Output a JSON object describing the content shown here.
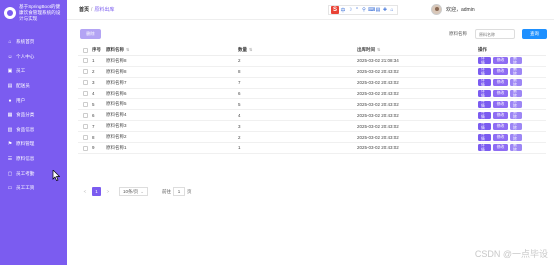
{
  "sidebar": {
    "title": "基于SpringBoot的健康饮食管理系统的设计与实现",
    "items": [
      {
        "label": "系统首页",
        "icon": "home-icon",
        "glyph": "⌂"
      },
      {
        "label": "个人中心",
        "icon": "user-icon",
        "glyph": "☺"
      },
      {
        "label": "员工",
        "icon": "id-card-icon",
        "glyph": "▣"
      },
      {
        "label": "配送员",
        "icon": "truck-icon",
        "glyph": "▤"
      },
      {
        "label": "用户",
        "icon": "users-icon",
        "glyph": "●"
      },
      {
        "label": "食品分类",
        "icon": "category-icon",
        "glyph": "▦"
      },
      {
        "label": "食品信息",
        "icon": "goods-icon",
        "glyph": "▥"
      },
      {
        "label": "原料管理",
        "icon": "flag-icon",
        "glyph": "⚑"
      },
      {
        "label": "原料信息",
        "icon": "list-icon",
        "glyph": "☰"
      },
      {
        "label": "员工考勤",
        "icon": "calendar-icon",
        "glyph": "▢"
      },
      {
        "label": "员工工资",
        "icon": "wallet-icon",
        "glyph": "▭"
      }
    ]
  },
  "header": {
    "crumb_home": "首页",
    "crumb_current": "原料出库",
    "greeting": "欢迎，admin",
    "toolbar_icons": [
      "S",
      "中",
      "☽",
      "°",
      "⚲",
      "⌨",
      "▤",
      "✚",
      "⌂"
    ]
  },
  "toolbar": {
    "delete_label": "删除",
    "search_label": "原料名称",
    "search_placeholder": "原料名称",
    "search_button": "查询"
  },
  "table": {
    "headers": {
      "index": "序号",
      "name": "原料名称",
      "qty": "数量",
      "time": "出库时间",
      "ops": "操作"
    },
    "op_labels": {
      "detail": "详情",
      "edit": "修改",
      "delete": "删除"
    },
    "rows": [
      {
        "index": "1",
        "name": "原料名称8",
        "qty": "2",
        "time": "2025-03-02 21:08:34"
      },
      {
        "index": "2",
        "name": "原料名称8",
        "qty": "8",
        "time": "2025-03-02 20:43:02"
      },
      {
        "index": "3",
        "name": "原料名称7",
        "qty": "7",
        "time": "2025-03-02 20:43:02"
      },
      {
        "index": "4",
        "name": "原料名称6",
        "qty": "6",
        "time": "2025-03-02 20:43:02"
      },
      {
        "index": "5",
        "name": "原料名称5",
        "qty": "5",
        "time": "2025-03-02 20:43:02"
      },
      {
        "index": "6",
        "name": "原料名称4",
        "qty": "4",
        "time": "2025-03-02 20:43:02"
      },
      {
        "index": "7",
        "name": "原料名称3",
        "qty": "3",
        "time": "2025-03-02 20:43:02"
      },
      {
        "index": "8",
        "name": "原料名称2",
        "qty": "2",
        "time": "2025-03-02 20:43:02"
      },
      {
        "index": "9",
        "name": "原料名称1",
        "qty": "1",
        "time": "2025-03-02 20:43:02"
      }
    ]
  },
  "pager": {
    "prev": "<",
    "current_page": "1",
    "next": ">",
    "page_size": "10条/页",
    "goto_label": "前往",
    "goto_value": "1",
    "goto_unit": "页"
  },
  "watermark": "CSDN @一点毕设",
  "colors": {
    "sidebar": "#7b5cf0",
    "accent": "#7b5cf0",
    "search_button": "#1e90ff"
  }
}
